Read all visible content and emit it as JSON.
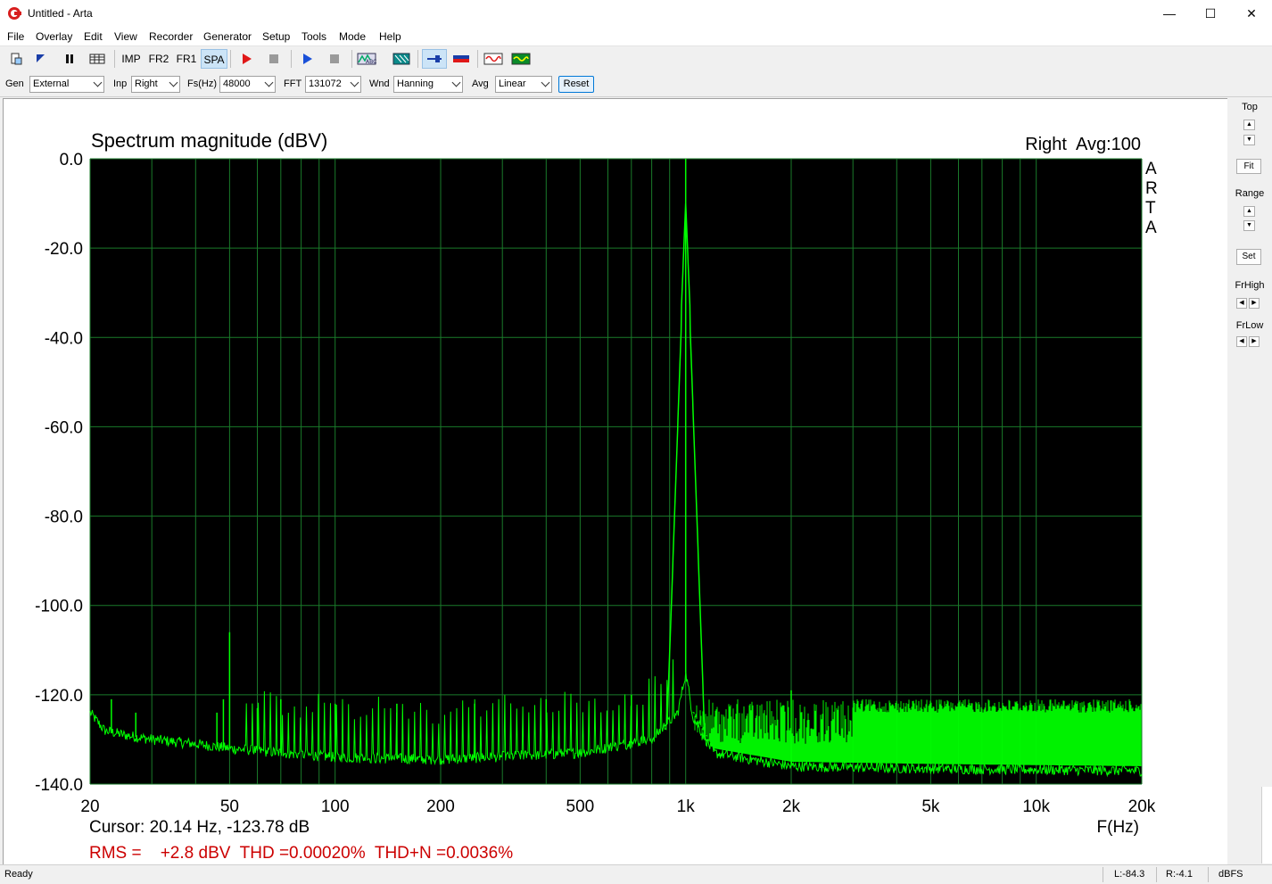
{
  "window": {
    "title": "Untitled - Arta",
    "minimize": "—",
    "maximize": "☐",
    "close": "✕"
  },
  "menu": [
    "File",
    "Overlay",
    "Edit",
    "View",
    "Recorder",
    "Generator",
    "Setup",
    "Tools",
    "Mode",
    "Help"
  ],
  "toolbar": {
    "imp": "IMP",
    "fr2": "FR2",
    "fr1": "FR1",
    "spa": "SPA"
  },
  "params": {
    "gen_label": "Gen",
    "gen_value": "External",
    "inp_label": "Inp",
    "inp_value": "Right",
    "fs_label": "Fs(Hz)",
    "fs_value": "48000",
    "fft_label": "FFT",
    "fft_value": "131072",
    "wnd_label": "Wnd",
    "wnd_value": "Hanning",
    "avg_label": "Avg",
    "avg_value": "Linear",
    "reset_label": "Reset"
  },
  "side": {
    "top_label": "Top",
    "fit_label": "Fit",
    "range_label": "Range",
    "set_label": "Set",
    "frhigh_label": "FrHigh",
    "frlow_label": "FrLow"
  },
  "chart_data": {
    "type": "line",
    "title": "Spectrum magnitude (dBV)",
    "channel_info": "Right  Avg:100",
    "watermark": [
      "A",
      "R",
      "T",
      "A"
    ],
    "xlabel": "F(Hz)",
    "x_scale": "log",
    "xlim": [
      20,
      20000
    ],
    "ylim": [
      -140,
      0
    ],
    "x_ticks": [
      {
        "value": 20,
        "label": "20"
      },
      {
        "value": 50,
        "label": "50"
      },
      {
        "value": 100,
        "label": "100"
      },
      {
        "value": 200,
        "label": "200"
      },
      {
        "value": 500,
        "label": "500"
      },
      {
        "value": 1000,
        "label": "1k"
      },
      {
        "value": 2000,
        "label": "2k"
      },
      {
        "value": 5000,
        "label": "5k"
      },
      {
        "value": 10000,
        "label": "10k"
      },
      {
        "value": 20000,
        "label": "20k"
      }
    ],
    "y_ticks": [
      {
        "value": 0,
        "label": "0.0"
      },
      {
        "value": -20,
        "label": "-20.0"
      },
      {
        "value": -40,
        "label": "-40.0"
      },
      {
        "value": -60,
        "label": "-60.0"
      },
      {
        "value": -80,
        "label": "-80.0"
      },
      {
        "value": -100,
        "label": "-100.0"
      },
      {
        "value": -120,
        "label": "-120.0"
      },
      {
        "value": -140,
        "label": "-140.0"
      }
    ],
    "grid": true,
    "series": [
      {
        "color": "#00ff00",
        "noise_floor": [
          [
            20,
            -124
          ],
          [
            22,
            -128
          ],
          [
            25,
            -129
          ],
          [
            30,
            -130
          ],
          [
            40,
            -131
          ],
          [
            50,
            -132
          ],
          [
            70,
            -133
          ],
          [
            100,
            -134
          ],
          [
            200,
            -134.5
          ],
          [
            500,
            -133
          ],
          [
            800,
            -130
          ],
          [
            950,
            -124
          ],
          [
            1000,
            -115
          ],
          [
            1050,
            -125
          ],
          [
            1200,
            -133
          ],
          [
            2000,
            -136
          ],
          [
            5000,
            -136.5
          ],
          [
            20000,
            -137
          ]
        ],
        "peaks": [
          {
            "f": 23,
            "db": -121
          },
          {
            "f": 27,
            "db": -124
          },
          {
            "f": 46,
            "db": -124
          },
          {
            "f": 48,
            "db": -121
          },
          {
            "f": 50,
            "db": -106
          },
          {
            "f": 60,
            "db": -123
          },
          {
            "f": 70,
            "db": -121
          },
          {
            "f": 100,
            "db": -122
          },
          {
            "f": 150,
            "db": -122
          },
          {
            "f": 250,
            "db": -122
          },
          {
            "f": 400,
            "db": -121
          },
          {
            "f": 700,
            "db": -120
          },
          {
            "f": 1000,
            "db": 0
          },
          {
            "f": 2000,
            "db": -119
          }
        ],
        "dense_band_hf": {
          "from": 1050,
          "to": 20000,
          "top_db": -121,
          "bottom_db": -137
        }
      }
    ],
    "cursor_text": "Cursor: 20.14 Hz, -123.78 dB",
    "measurements": "RMS =    +2.8 dBV  THD =0.00020%  THD+N =0.0036%",
    "bg_color": "#000000",
    "grid_color": "#1a7a2a",
    "trace_color": "#00ff00",
    "measure_color": "#cc0000"
  },
  "status": {
    "ready": "Ready",
    "left_level": "L:-84.3",
    "right_level": "R:-4.1",
    "units": "dBFS"
  }
}
